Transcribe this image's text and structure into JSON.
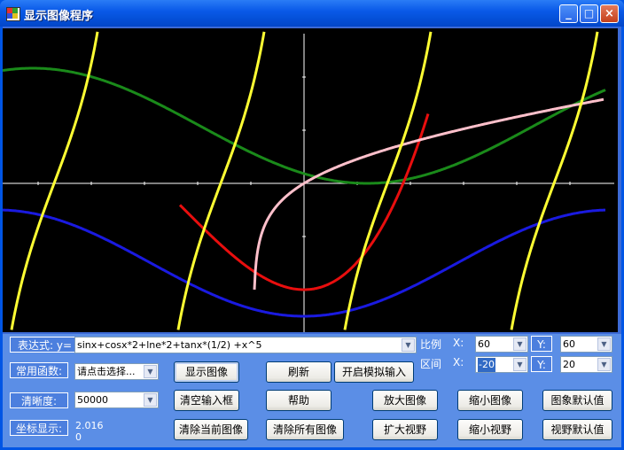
{
  "window": {
    "title": "显示图像程序",
    "controls": {
      "minimize": "_",
      "maximize": "□",
      "close": "×"
    }
  },
  "plot": {
    "curves": [
      {
        "name": "yellow",
        "color": "#ffff33"
      },
      {
        "name": "green",
        "color": "#1a8a1a"
      },
      {
        "name": "blue",
        "color": "#1a1ae0"
      },
      {
        "name": "red",
        "color": "#e80e0e"
      },
      {
        "name": "pink",
        "color": "#ffc0cb"
      }
    ]
  },
  "controls": {
    "expression_label": "表达式:",
    "y_label": "y=",
    "expression_value": "sinx+cosx*2+lne*2+tanx*(1/2) +x^5",
    "common_func_label": "常用函数:",
    "common_func_value": "请点击选择...",
    "resolution_label": "清晰度:",
    "resolution_value": "50000",
    "coord_label": "坐标显示:",
    "coord_x": "2.016",
    "coord_y": "0",
    "scale_label": "比例",
    "scale_x_label": "X:",
    "scale_x_value": "60",
    "scale_y_label": "Y:",
    "scale_y_value": "60",
    "range_label": "区间",
    "range_x_label": "X:",
    "range_x_value": "-20",
    "range_y_label": "Y:",
    "range_y_value": "20"
  },
  "buttons": {
    "show_image": "显示图像",
    "refresh": "刷新",
    "simulate_input": "开启模拟输入",
    "clear_input": "清空输入框",
    "help": "帮助",
    "zoom_in_image": "放大图像",
    "zoom_out_image": "缩小图像",
    "image_default": "图象默认值",
    "clear_current": "清除当前图像",
    "clear_all": "清除所有图像",
    "expand_view": "扩大视野",
    "shrink_view": "缩小视野",
    "view_default": "视野默认值"
  }
}
